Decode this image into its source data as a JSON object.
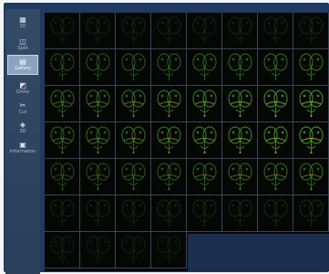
{
  "sidebar": {
    "tools": [
      {
        "name": "tool-2d",
        "icon": "grid-icon",
        "glyph": "▦",
        "label": "2D"
      },
      {
        "name": "tool-split",
        "icon": "split-view-icon",
        "glyph": "◫",
        "label": "Split"
      },
      {
        "name": "tool-gallery",
        "icon": "gallery-icon",
        "glyph": "▤",
        "label": "Gallery",
        "active": true
      },
      {
        "name": "tool-ortho",
        "icon": "ortho-icon",
        "glyph": "◩",
        "label": "Ortho"
      },
      {
        "name": "tool-cut",
        "icon": "cut-icon",
        "glyph": "✂",
        "label": "Cut"
      },
      {
        "name": "tool-3d",
        "icon": "3d-icon",
        "glyph": "◈",
        "label": "3D"
      },
      {
        "name": "tool-information",
        "icon": "information-icon",
        "glyph": "▣",
        "label": "Information"
      }
    ]
  },
  "gallery": {
    "tile_count": 52,
    "columns": 8,
    "colors": {
      "background": "#050705",
      "green_signal": "#3f9a2c",
      "yellow_signal": "#c9b12a",
      "grid_line": "#3c4452",
      "empty_panel": "#1b2e4e"
    }
  }
}
